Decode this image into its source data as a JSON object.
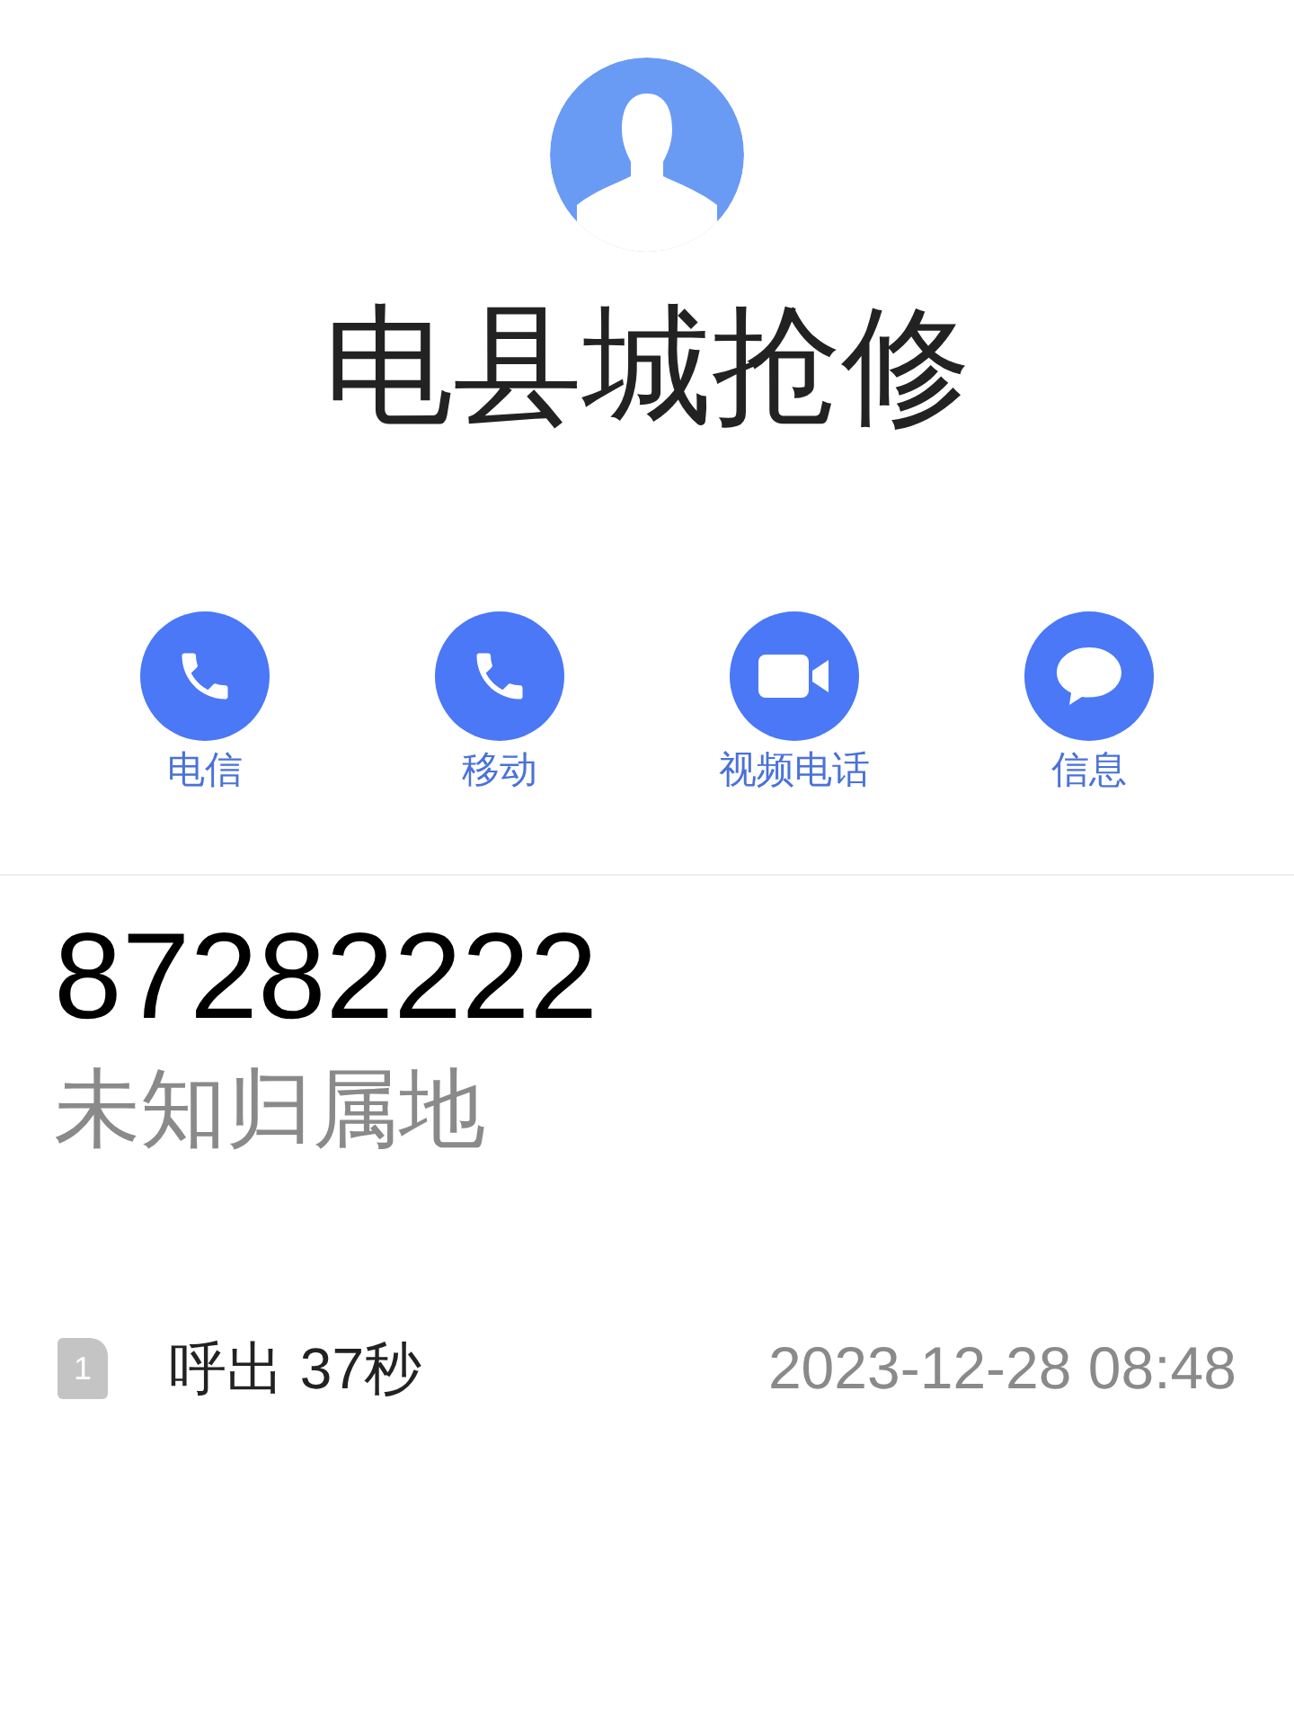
{
  "contact": {
    "name": "电县城抢修"
  },
  "actions": [
    {
      "kind": "phone",
      "label": "电信"
    },
    {
      "kind": "phone",
      "label": "移动"
    },
    {
      "kind": "video",
      "label": "视频电话"
    },
    {
      "kind": "message",
      "label": "信息"
    }
  ],
  "number": {
    "value": "87282222",
    "location": "未知归属地"
  },
  "call_log": [
    {
      "sim": "1",
      "type_duration": "呼出 37秒",
      "time": "2023-12-28 08:48"
    }
  ]
}
